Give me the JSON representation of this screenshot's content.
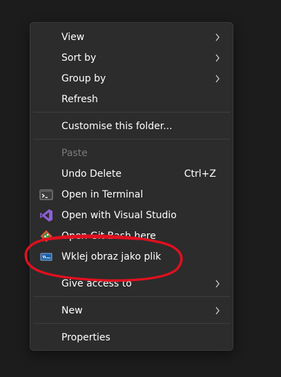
{
  "menu": {
    "view": "View",
    "sort_by": "Sort by",
    "group_by": "Group by",
    "refresh": "Refresh",
    "customise": "Customise this folder...",
    "paste": "Paste",
    "undo_delete": "Undo Delete",
    "undo_shortcut": "Ctrl+Z",
    "open_terminal": "Open in Terminal",
    "open_vs": "Open with Visual Studio",
    "open_git": "Open Git Bash here",
    "paste_image": "Wklej obraz jako plik",
    "give_access": "Give access to",
    "new": "New",
    "properties": "Properties"
  },
  "icons": {
    "terminal": "terminal-icon",
    "visual_studio": "visual-studio-icon",
    "git_bash": "git-bash-icon",
    "paste_image": "paste-image-icon",
    "submenu": "chevron-right-icon"
  },
  "colors": {
    "menu_bg": "#2c2c2c",
    "text": "#ffffff",
    "disabled_text": "#7b7b7b",
    "annotation": "#e0101f",
    "vs_purple": "#8b5fd6",
    "git_orange": "#f05133"
  }
}
